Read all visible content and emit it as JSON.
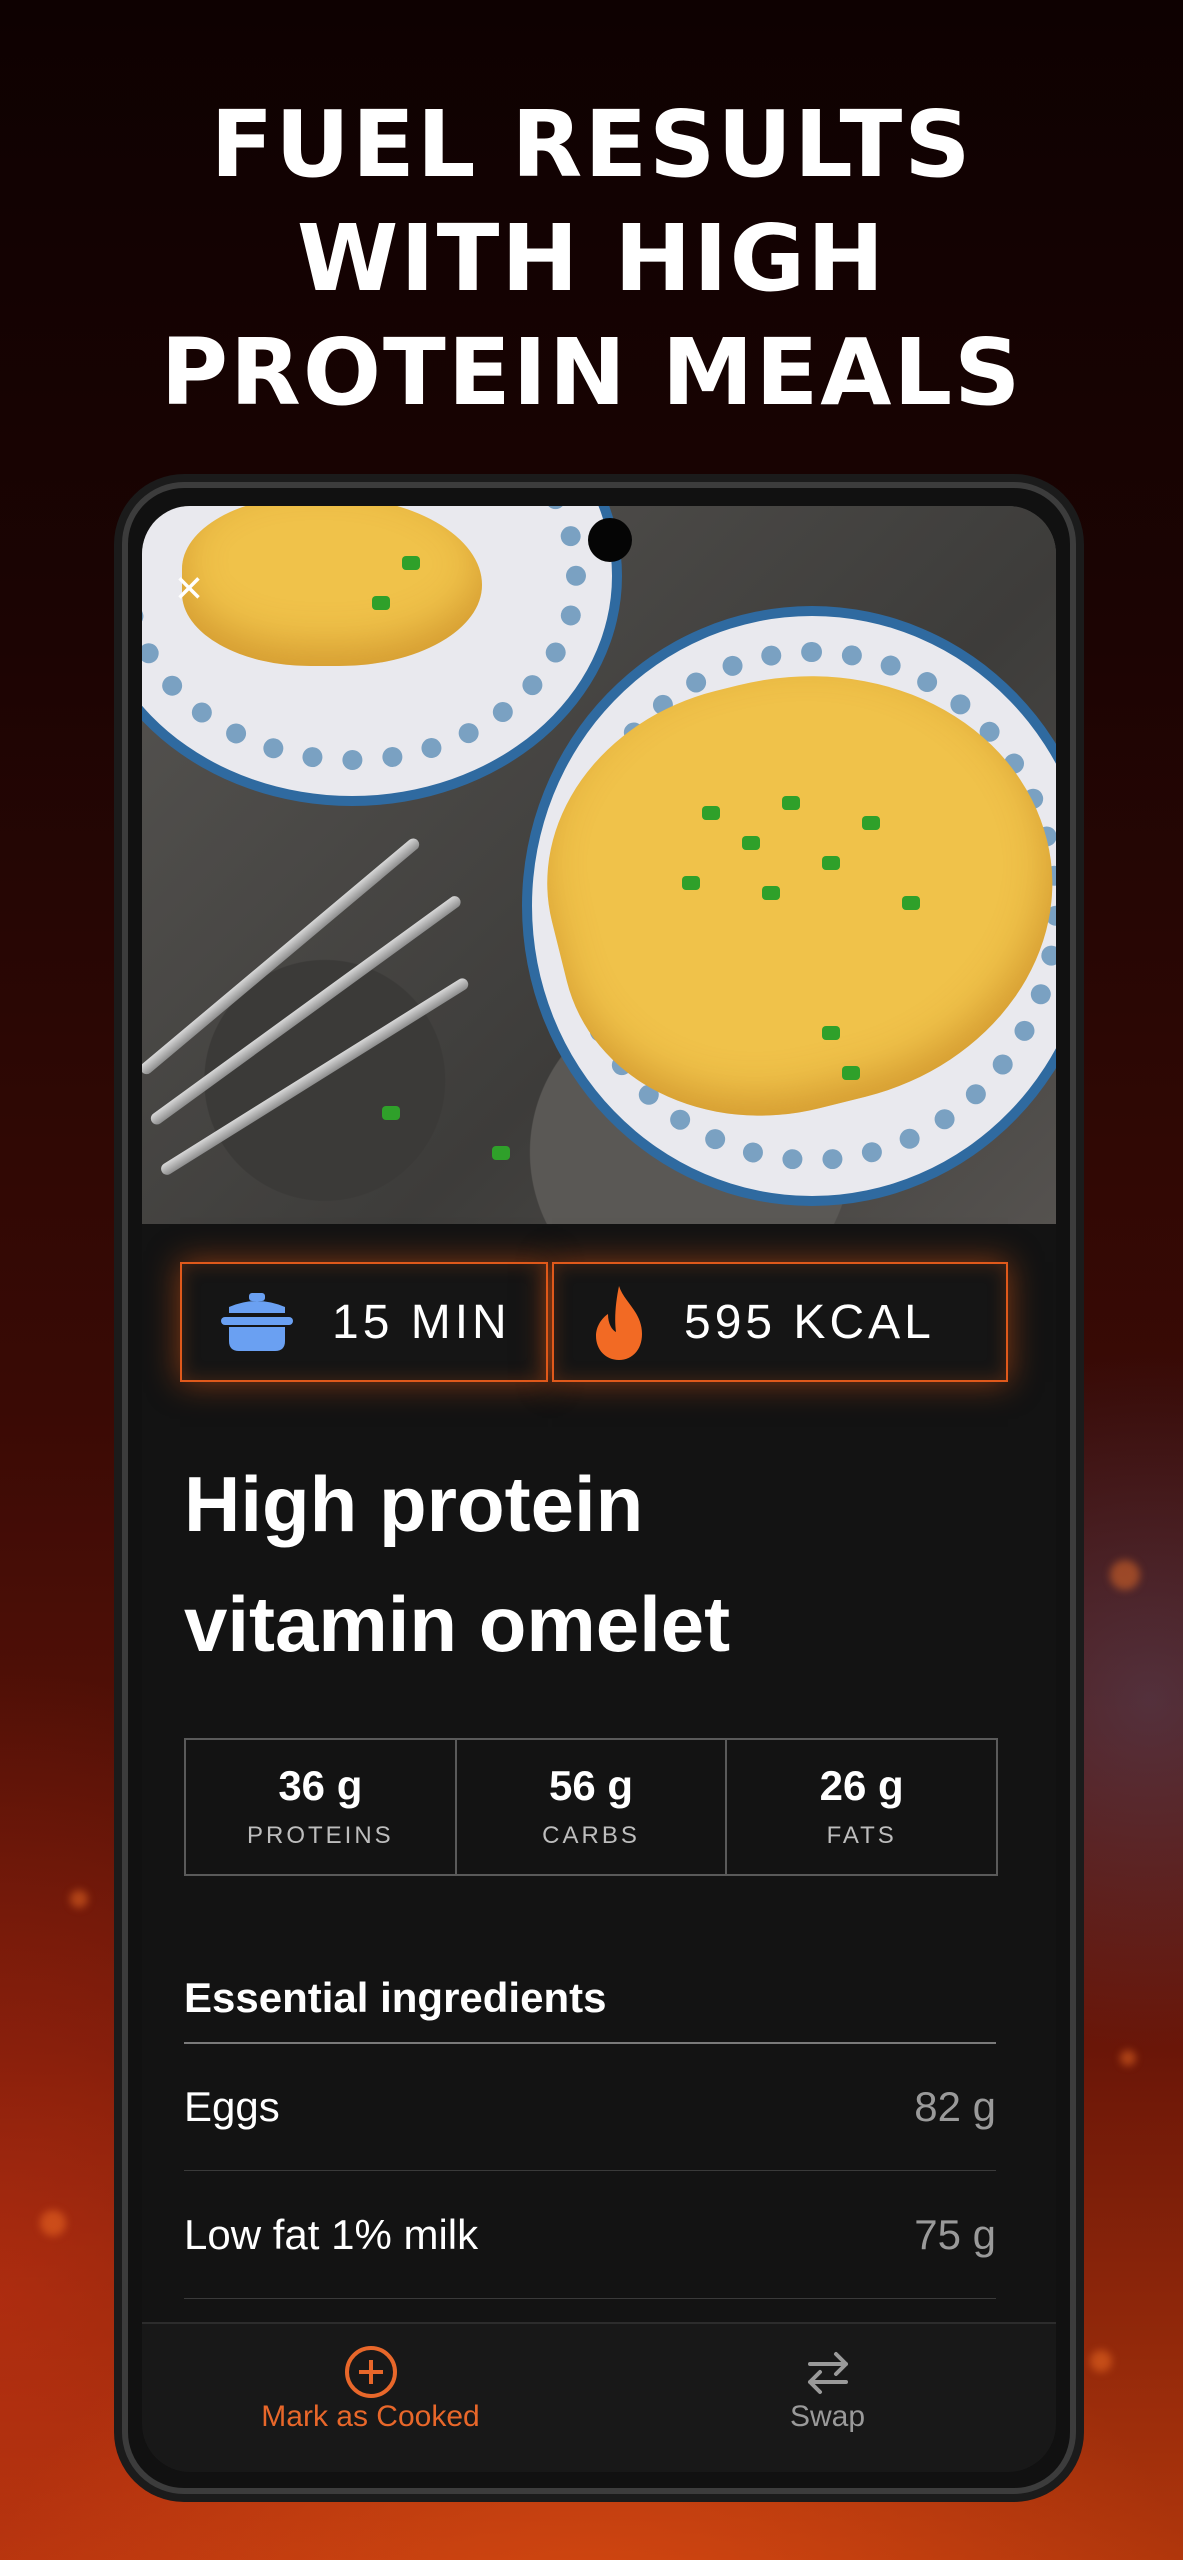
{
  "headline": [
    "FUEL RESULTS",
    "WITH HIGH",
    "PROTEIN MEALS"
  ],
  "colors": {
    "accent": "#e8672a",
    "stat_border": "#e0591b",
    "time_icon": "#6aa0f2"
  },
  "recipe": {
    "time": "15 MIN",
    "calories": "595 KCAL",
    "title_lines": [
      "High protein",
      "vitamin omelet"
    ],
    "macros": [
      {
        "value": "36 g",
        "label": "PROTEINS"
      },
      {
        "value": "56 g",
        "label": "CARBS"
      },
      {
        "value": "26 g",
        "label": "FATS"
      }
    ],
    "ingredients_heading": "Essential ingredients",
    "ingredients": [
      {
        "name": "Eggs",
        "amount": "82 g"
      },
      {
        "name": "Low fat 1% milk",
        "amount": "75 g"
      }
    ]
  },
  "icons": {
    "close": "close-icon",
    "time": "pot-icon",
    "calories": "flame-icon",
    "cooked": "plus-circle-icon",
    "swap": "swap-arrows-icon"
  },
  "bottom_bar": {
    "cooked_label": "Mark as Cooked",
    "swap_label": "Swap"
  }
}
